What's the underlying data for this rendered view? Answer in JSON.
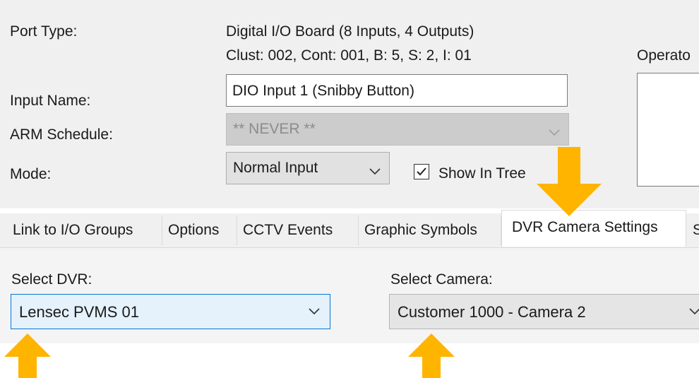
{
  "form": {
    "port_type_label": "Port Type:",
    "port_type_value": "Digital I/O Board (8 Inputs, 4 Outputs)",
    "port_address": "Clust: 002, Cont: 001, B: 5, S: 2, I: 01",
    "operator_label": "Operato",
    "input_name_label": "Input Name:",
    "input_name_value": "DIO Input 1 (Snibby Button)",
    "arm_schedule_label": "ARM Schedule:",
    "arm_schedule_value": "** NEVER **",
    "mode_label": "Mode:",
    "mode_value": "Normal Input",
    "show_in_tree_label": "Show In Tree",
    "show_in_tree_checked": true
  },
  "tabs": [
    {
      "label": "Link to I/O Groups",
      "active": false
    },
    {
      "label": "Options",
      "active": false
    },
    {
      "label": "CCTV Events",
      "active": false
    },
    {
      "label": "Graphic Symbols",
      "active": false
    },
    {
      "label": "DVR Camera Settings",
      "active": true
    },
    {
      "label": "S",
      "active": false
    }
  ],
  "dvr_settings": {
    "select_dvr_label": "Select DVR:",
    "select_dvr_value": "Lensec PVMS 01",
    "select_camera_label": "Select Camera:",
    "select_camera_value": "Customer 1000 - Camera 2"
  },
  "colors": {
    "callout_arrow": "#ffb400",
    "focus_border": "#0078d7"
  },
  "icons": {
    "dropdown": "chevron-down-icon",
    "check": "check-icon",
    "callout": "arrow-callout-icon"
  }
}
